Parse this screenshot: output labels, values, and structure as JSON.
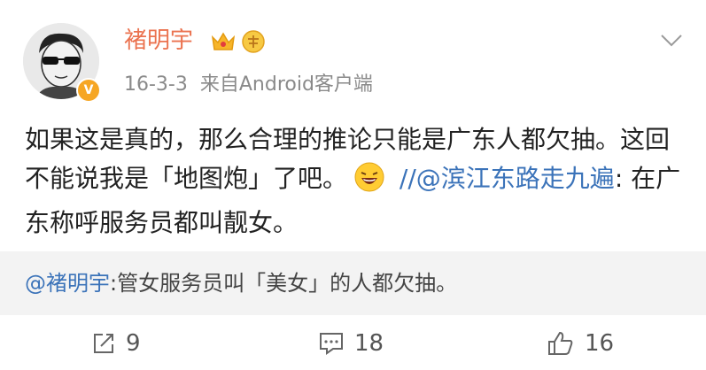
{
  "post": {
    "author": "褚明宇",
    "badges": [
      "crown-icon",
      "answer-badge-icon"
    ],
    "verified_mark": "V",
    "date": "16-3-3",
    "source": "来自Android客户端",
    "text_part1": "如果这是真的，那么合理的推论只能是广东人都欠抽。这回不能说我是「地图炮」了吧。",
    "emoji": "laughing-emoji",
    "forward_sep": " //",
    "forward_mention": "@滨江东路走九遍",
    "forward_text": ": 在广东称呼服务员都叫靓女。"
  },
  "repost": {
    "mention": "@褚明宇",
    "text": ":管女服务员叫「美女」的人都欠抽。"
  },
  "actions": {
    "share_count": "9",
    "comment_count": "18",
    "like_count": "16"
  },
  "colors": {
    "username": "#eb7350",
    "mention": "#3b73b9",
    "repost_bg": "#f3f3f3"
  }
}
